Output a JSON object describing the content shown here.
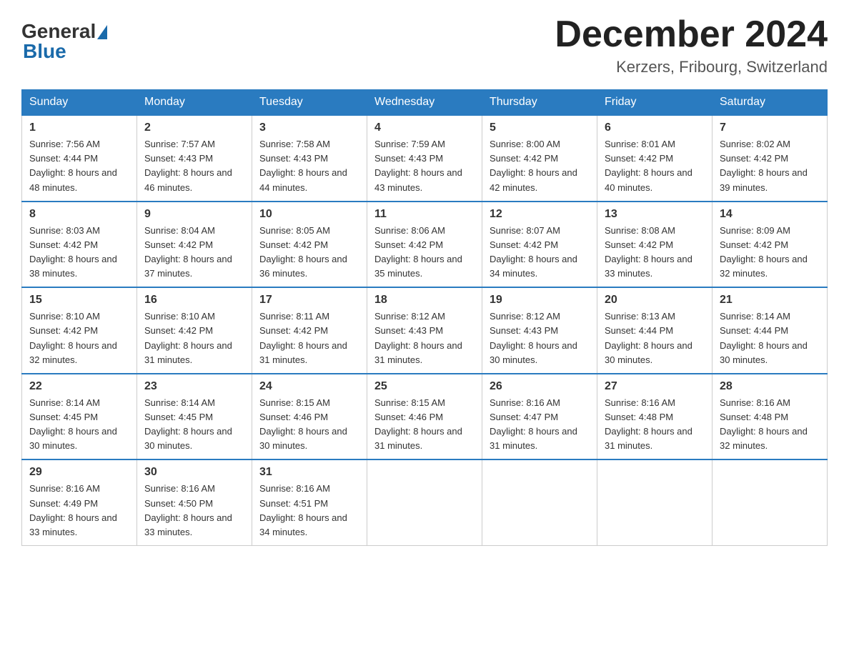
{
  "logo": {
    "general": "General",
    "blue": "Blue"
  },
  "title": "December 2024",
  "location": "Kerzers, Fribourg, Switzerland",
  "days_of_week": [
    "Sunday",
    "Monday",
    "Tuesday",
    "Wednesday",
    "Thursday",
    "Friday",
    "Saturday"
  ],
  "weeks": [
    [
      {
        "day": "1",
        "sunrise": "7:56 AM",
        "sunset": "4:44 PM",
        "daylight": "8 hours and 48 minutes."
      },
      {
        "day": "2",
        "sunrise": "7:57 AM",
        "sunset": "4:43 PM",
        "daylight": "8 hours and 46 minutes."
      },
      {
        "day": "3",
        "sunrise": "7:58 AM",
        "sunset": "4:43 PM",
        "daylight": "8 hours and 44 minutes."
      },
      {
        "day": "4",
        "sunrise": "7:59 AM",
        "sunset": "4:43 PM",
        "daylight": "8 hours and 43 minutes."
      },
      {
        "day": "5",
        "sunrise": "8:00 AM",
        "sunset": "4:42 PM",
        "daylight": "8 hours and 42 minutes."
      },
      {
        "day": "6",
        "sunrise": "8:01 AM",
        "sunset": "4:42 PM",
        "daylight": "8 hours and 40 minutes."
      },
      {
        "day": "7",
        "sunrise": "8:02 AM",
        "sunset": "4:42 PM",
        "daylight": "8 hours and 39 minutes."
      }
    ],
    [
      {
        "day": "8",
        "sunrise": "8:03 AM",
        "sunset": "4:42 PM",
        "daylight": "8 hours and 38 minutes."
      },
      {
        "day": "9",
        "sunrise": "8:04 AM",
        "sunset": "4:42 PM",
        "daylight": "8 hours and 37 minutes."
      },
      {
        "day": "10",
        "sunrise": "8:05 AM",
        "sunset": "4:42 PM",
        "daylight": "8 hours and 36 minutes."
      },
      {
        "day": "11",
        "sunrise": "8:06 AM",
        "sunset": "4:42 PM",
        "daylight": "8 hours and 35 minutes."
      },
      {
        "day": "12",
        "sunrise": "8:07 AM",
        "sunset": "4:42 PM",
        "daylight": "8 hours and 34 minutes."
      },
      {
        "day": "13",
        "sunrise": "8:08 AM",
        "sunset": "4:42 PM",
        "daylight": "8 hours and 33 minutes."
      },
      {
        "day": "14",
        "sunrise": "8:09 AM",
        "sunset": "4:42 PM",
        "daylight": "8 hours and 32 minutes."
      }
    ],
    [
      {
        "day": "15",
        "sunrise": "8:10 AM",
        "sunset": "4:42 PM",
        "daylight": "8 hours and 32 minutes."
      },
      {
        "day": "16",
        "sunrise": "8:10 AM",
        "sunset": "4:42 PM",
        "daylight": "8 hours and 31 minutes."
      },
      {
        "day": "17",
        "sunrise": "8:11 AM",
        "sunset": "4:42 PM",
        "daylight": "8 hours and 31 minutes."
      },
      {
        "day": "18",
        "sunrise": "8:12 AM",
        "sunset": "4:43 PM",
        "daylight": "8 hours and 31 minutes."
      },
      {
        "day": "19",
        "sunrise": "8:12 AM",
        "sunset": "4:43 PM",
        "daylight": "8 hours and 30 minutes."
      },
      {
        "day": "20",
        "sunrise": "8:13 AM",
        "sunset": "4:44 PM",
        "daylight": "8 hours and 30 minutes."
      },
      {
        "day": "21",
        "sunrise": "8:14 AM",
        "sunset": "4:44 PM",
        "daylight": "8 hours and 30 minutes."
      }
    ],
    [
      {
        "day": "22",
        "sunrise": "8:14 AM",
        "sunset": "4:45 PM",
        "daylight": "8 hours and 30 minutes."
      },
      {
        "day": "23",
        "sunrise": "8:14 AM",
        "sunset": "4:45 PM",
        "daylight": "8 hours and 30 minutes."
      },
      {
        "day": "24",
        "sunrise": "8:15 AM",
        "sunset": "4:46 PM",
        "daylight": "8 hours and 30 minutes."
      },
      {
        "day": "25",
        "sunrise": "8:15 AM",
        "sunset": "4:46 PM",
        "daylight": "8 hours and 31 minutes."
      },
      {
        "day": "26",
        "sunrise": "8:16 AM",
        "sunset": "4:47 PM",
        "daylight": "8 hours and 31 minutes."
      },
      {
        "day": "27",
        "sunrise": "8:16 AM",
        "sunset": "4:48 PM",
        "daylight": "8 hours and 31 minutes."
      },
      {
        "day": "28",
        "sunrise": "8:16 AM",
        "sunset": "4:48 PM",
        "daylight": "8 hours and 32 minutes."
      }
    ],
    [
      {
        "day": "29",
        "sunrise": "8:16 AM",
        "sunset": "4:49 PM",
        "daylight": "8 hours and 33 minutes."
      },
      {
        "day": "30",
        "sunrise": "8:16 AM",
        "sunset": "4:50 PM",
        "daylight": "8 hours and 33 minutes."
      },
      {
        "day": "31",
        "sunrise": "8:16 AM",
        "sunset": "4:51 PM",
        "daylight": "8 hours and 34 minutes."
      },
      null,
      null,
      null,
      null
    ]
  ],
  "labels": {
    "sunrise": "Sunrise: ",
    "sunset": "Sunset: ",
    "daylight": "Daylight: "
  }
}
